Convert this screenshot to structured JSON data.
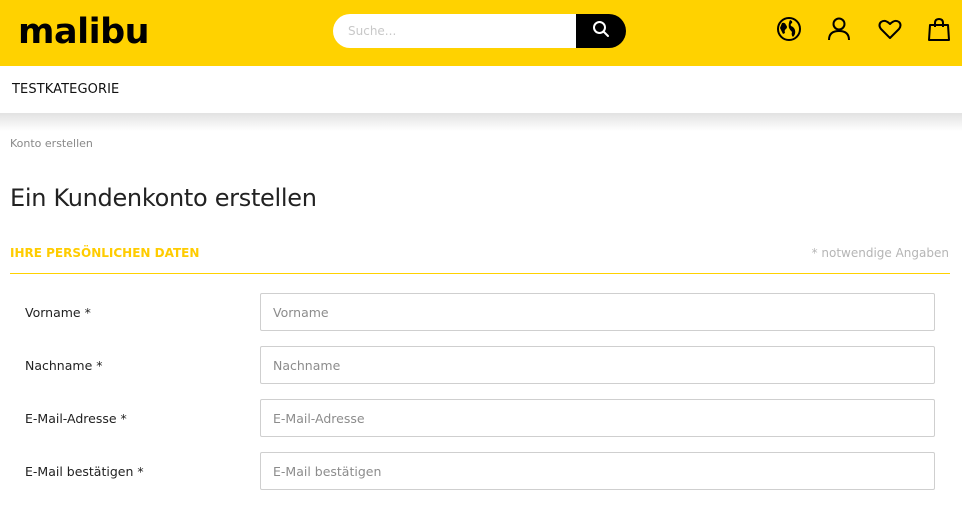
{
  "header": {
    "logo_text": "malibu",
    "search": {
      "placeholder": "Suche..."
    },
    "icons": [
      "globe-icon",
      "user-icon",
      "heart-icon",
      "bag-icon"
    ],
    "brand_color": "#ffd200"
  },
  "nav": {
    "items": [
      {
        "label": "TESTKATEGORIE"
      }
    ]
  },
  "breadcrumb": {
    "current": "Konto erstellen"
  },
  "page": {
    "title": "Ein Kundenkonto erstellen"
  },
  "form": {
    "section_title": "IHRE PERSÖNLICHEN DATEN",
    "required_note": "* notwendige Angaben",
    "fields": [
      {
        "label": "Vorname *",
        "placeholder": "Vorname"
      },
      {
        "label": "Nachname *",
        "placeholder": "Nachname"
      },
      {
        "label": "E-Mail-Adresse *",
        "placeholder": "E-Mail-Adresse"
      },
      {
        "label": "E-Mail bestätigen *",
        "placeholder": "E-Mail bestätigen"
      }
    ]
  }
}
